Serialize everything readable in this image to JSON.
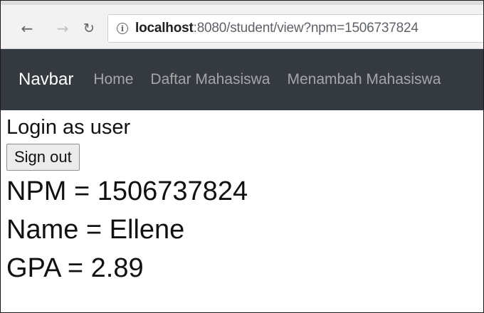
{
  "browser": {
    "url_host": "localhost",
    "url_rest": ":8080/student/view?npm=1506737824",
    "back_icon": "arrow-left",
    "forward_icon": "arrow-right",
    "reload_icon": "reload",
    "info_icon": "info"
  },
  "navbar": {
    "brand": "Navbar",
    "links": [
      "Home",
      "Daftar Mahasiswa",
      "Menambah Mahasiswa"
    ]
  },
  "page": {
    "login_text": "Login as user",
    "signout_label": "Sign out",
    "npm_line": "NPM = 1506737824",
    "name_line": "Name = Ellene",
    "gpa_line": "GPA = 2.89"
  }
}
